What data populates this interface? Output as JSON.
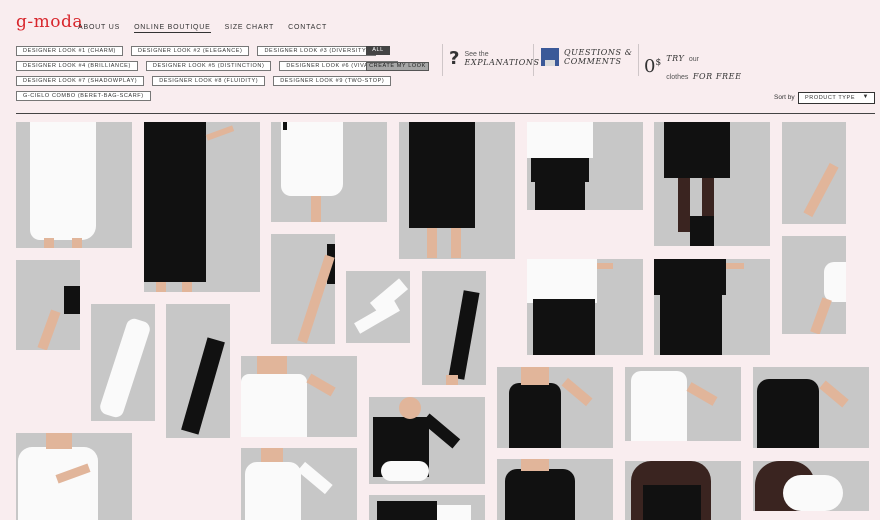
{
  "brand": {
    "logo": "g-moda"
  },
  "nav": [
    "ABOUT US",
    "ONLINE BOUTIQUE",
    "SIZE CHART",
    "CONTACT"
  ],
  "looks": [
    [
      "DESIGNER LOOK #1 (CHARM)",
      "DESIGNER LOOK #2 (ELEGANCE)",
      "DESIGNER LOOK #3 (DIVERSITY)"
    ],
    [
      "DESIGNER LOOK #4 (BRILLIANCE)",
      "DESIGNER LOOK #5 (DISTINCTION)",
      "DESIGNER LOOK #6 (VIVACIOUS)"
    ],
    [
      "DESIGNER LOOK #7 (SHADOWPLAY)",
      "DESIGNER LOOK #8 (FLUIDITY)",
      "DESIGNER LOOK #9 (TWO-STOP)"
    ],
    [
      "G-CIELO COMBO (BERET-BAG-SCARF)"
    ]
  ],
  "filters": {
    "all": "ALL",
    "create": "CREATE MY LOOK"
  },
  "info": {
    "explain_small": "See the",
    "explain_big": "EXPLANATIONS",
    "questions_big": "QUESTIONS &",
    "comments_big": "COMMENTS",
    "try_big": "TRY",
    "try_small": "our",
    "clothes_small": "clothes",
    "free_big": "FOR FREE",
    "price_zero": "0",
    "price_currency": "$"
  },
  "sort": {
    "label": "Sort by",
    "selected": "PRODUCT TYPE"
  },
  "colors": {
    "background": "#f9edef",
    "accent": "#d8262c",
    "photo_bg": "#c7c7c7"
  }
}
